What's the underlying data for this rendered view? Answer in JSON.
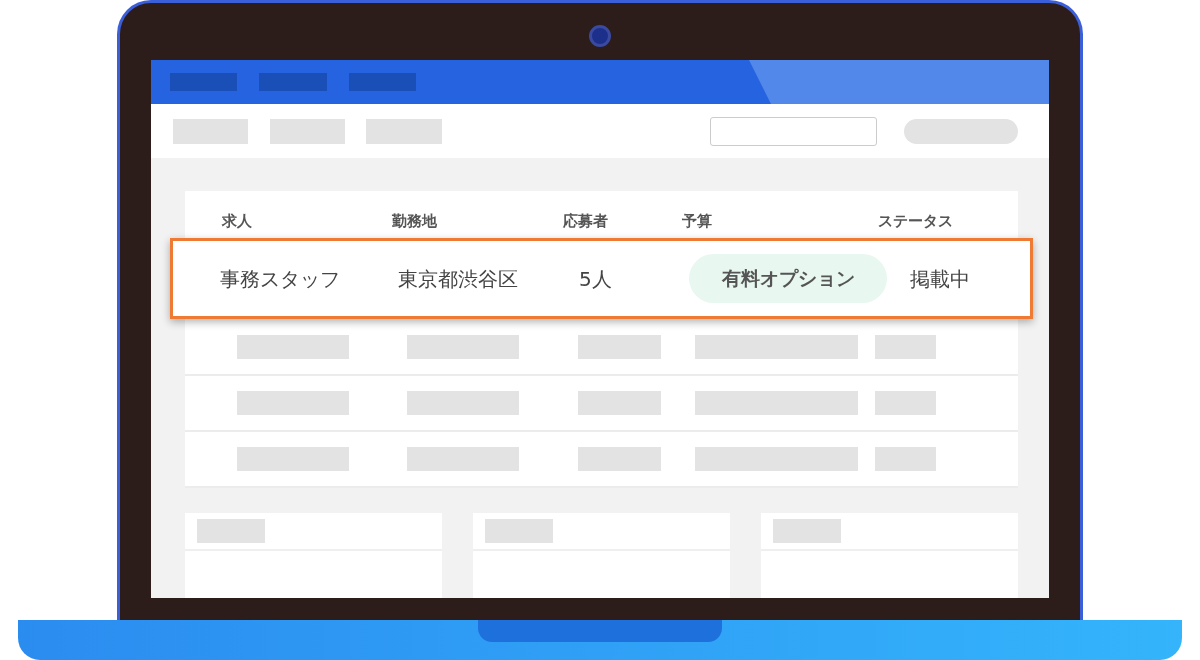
{
  "table": {
    "columns": [
      "求人",
      "勤務地",
      "応募者",
      "予算",
      "ステータス"
    ],
    "highlighted_row": {
      "selected": true,
      "cells": [
        {
          "kind": "text",
          "text": "事務スタッフ"
        },
        {
          "kind": "text",
          "text": "東京都渋谷区"
        },
        {
          "kind": "text",
          "text": "5人"
        },
        {
          "kind": "badge",
          "text": "有料オプション"
        },
        {
          "kind": "text",
          "text": "掲載中"
        }
      ]
    }
  }
}
